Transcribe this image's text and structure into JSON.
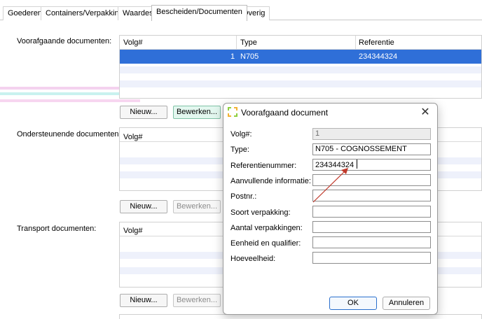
{
  "tabs": [
    {
      "label": "Goederen"
    },
    {
      "label": "Containers/Verpakking"
    },
    {
      "label": "Waardes"
    },
    {
      "label": "Bescheiden/Documenten"
    },
    {
      "label": "Overig"
    }
  ],
  "sections": {
    "voorafgaande": {
      "label": "Voorafgaande documenten:",
      "columns": [
        "Volg#",
        "Type",
        "Referentie"
      ],
      "rows": [
        {
          "volg": "1",
          "type": "N705",
          "referentie": "234344324"
        }
      ],
      "buttons": {
        "new": "Nieuw...",
        "edit": "Bewerken..."
      }
    },
    "ondersteunende": {
      "label": "Ondersteunende documenten:",
      "columns": [
        "Volg#"
      ],
      "buttons": {
        "new": "Nieuw...",
        "edit": "Bewerken..."
      }
    },
    "transport": {
      "label": "Transport documenten:",
      "columns": [
        "Volg#"
      ],
      "buttons": {
        "new": "Nieuw...",
        "edit": "Bewerken..."
      }
    }
  },
  "dialog": {
    "title": "Voorafgaand document",
    "fields": [
      {
        "label": "Volg#:",
        "value": "1"
      },
      {
        "label": "Type:",
        "value": "N705 - COGNOSSEMENT"
      },
      {
        "label": "Referentienummer:",
        "value": "234344324"
      },
      {
        "label": "Aanvullende informatie:",
        "value": ""
      },
      {
        "label": "Postnr.:",
        "value": ""
      },
      {
        "label": "Soort verpakking:",
        "value": ""
      },
      {
        "label": "Aantal verpakkingen:",
        "value": ""
      },
      {
        "label": "Eenheid en qualifier:",
        "value": ""
      },
      {
        "label": "Hoeveelheid:",
        "value": ""
      }
    ],
    "ok_label": "OK",
    "cancel_label": "Annuleren"
  },
  "colors": {
    "selection": "#2f6fd8",
    "arrow": "#c0392b",
    "accent_green": "#7fc2a6"
  },
  "icons": {
    "dialog": "app-logo-icon",
    "close": "close-icon"
  }
}
